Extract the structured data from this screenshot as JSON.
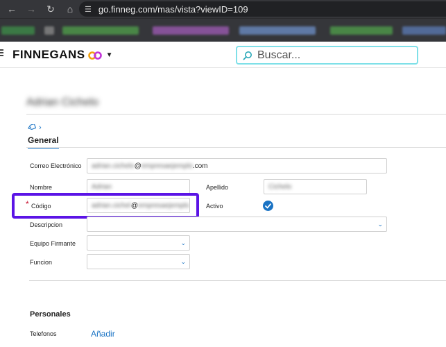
{
  "browser": {
    "url": "go.finneg.com/mas/vista?viewID=109"
  },
  "header": {
    "brand": "FINNEGANS",
    "search_placeholder": "Buscar..."
  },
  "page": {
    "title": "Adrian Cichelo",
    "tab_general": "General"
  },
  "form": {
    "correo": {
      "label": "Correo Electrónico",
      "value_blurred": "adrian.cichelo",
      "at": "@",
      "domain_blurred": "empresaejemplo",
      "suffix": ".com"
    },
    "nombre": {
      "label": "Nombre",
      "value": "Adrian"
    },
    "apellido": {
      "label": "Apellido",
      "value": "Cichelo"
    },
    "codigo": {
      "label": "Código",
      "required_mark": "*",
      "value_blurred": "adrian.cichelo",
      "at": "@",
      "domain_blurred": "empresaejemplo"
    },
    "activo": {
      "label": "Activo",
      "checked": true
    },
    "descripcion": {
      "label": "Descripcion"
    },
    "equipo_firmante": {
      "label": "Equipo Firmante"
    },
    "funcion": {
      "label": "Funcion"
    }
  },
  "personales": {
    "title": "Personales",
    "telefonos_label": "Telefonos",
    "add_label": "Añadir"
  },
  "colors": {
    "accent": "#1a73c4",
    "highlight": "#5b14e6",
    "search_border": "#7fe0e8"
  }
}
